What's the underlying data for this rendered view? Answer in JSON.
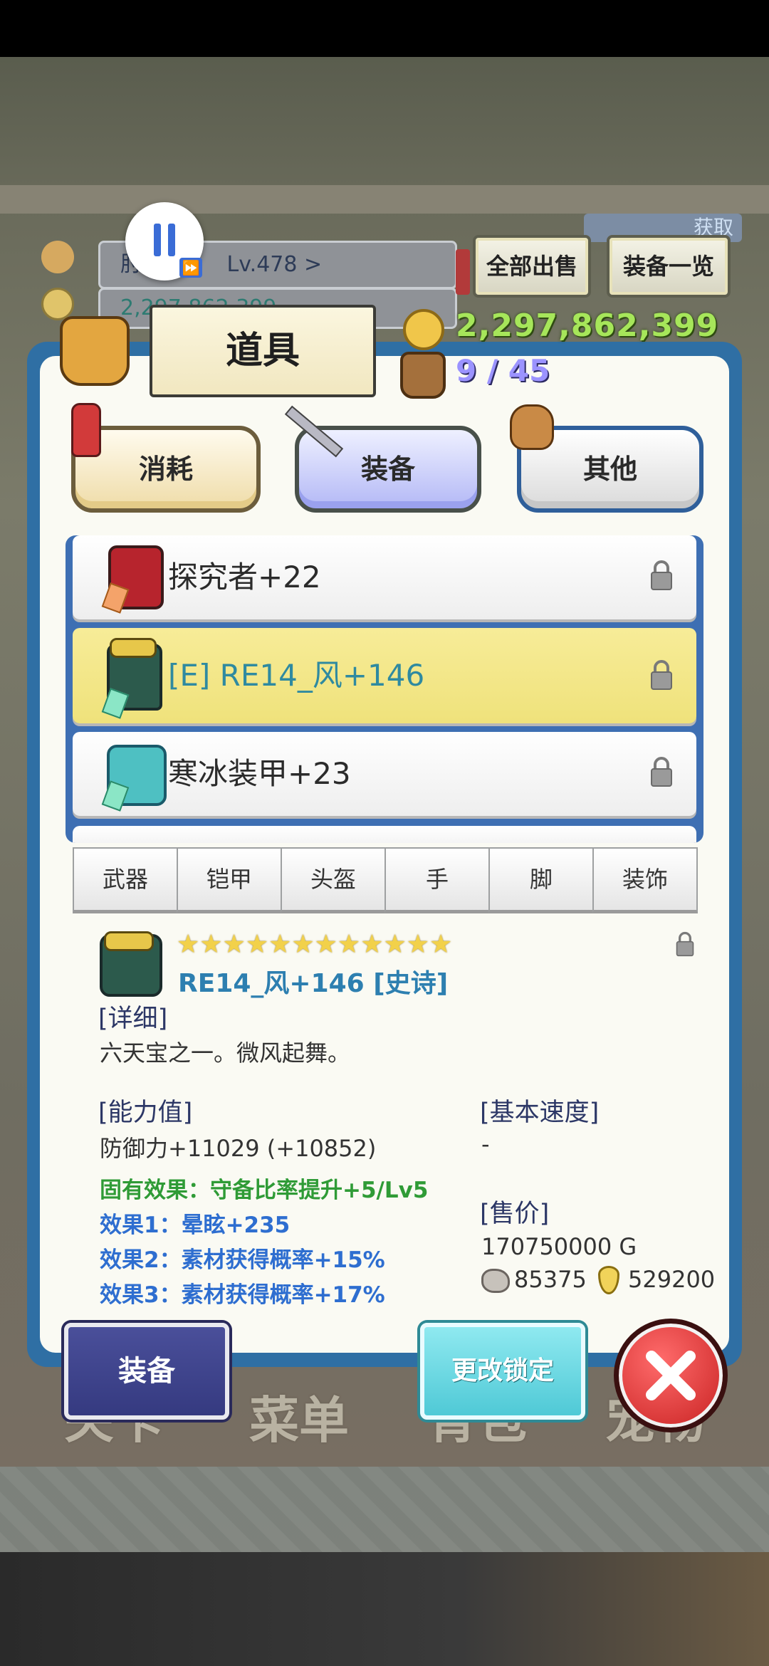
{
  "background_nav": [
    "关卡",
    "菜单",
    "背包",
    "宠物"
  ],
  "hud": {
    "player_level": "Lv.478 >",
    "player_name_fragment": "肘",
    "gold_behind": "2,297,862,399",
    "sell_all_label": "全部出售",
    "equip_list_label": "装备一览",
    "obtain_label": "获取"
  },
  "panel": {
    "title": "道具",
    "gold": "2,297,862,399",
    "slots": "9 / 45",
    "tabs": [
      "消耗",
      "装备",
      "其他"
    ],
    "selected_tab": "装备",
    "items": [
      {
        "name": "探究者+22",
        "selected": false
      },
      {
        "name": "[E] RE14_风+146",
        "selected": true
      },
      {
        "name": "寒冰装甲+23",
        "selected": false
      }
    ],
    "categories": [
      "武器",
      "铠甲",
      "头盔",
      "手",
      "脚",
      "装饰"
    ]
  },
  "detail": {
    "stars": "★★★★★★★★★★★★",
    "item_title": "RE14_风+146 [史诗]",
    "detail_header": "[详细]",
    "description": "六天宝之一。微风起舞。",
    "ability_header": "[能力值]",
    "defense": "防御力+11029 (+10852)",
    "inherent_effect": "固有效果：守备比率提升+5/Lv5",
    "effect1": "效果1：晕眩+235",
    "effect2": "效果2：素材获得概率+15%",
    "effect3": "效果3：素材获得概率+17%",
    "speed_header": "[基本速度]",
    "speed_value": "-",
    "price_header": "[售价]",
    "price": "170750000 G",
    "stone_value": "85375",
    "drop_value": "529200"
  },
  "buttons": {
    "equip_label": "装备",
    "change_lock_label": "更改锁定"
  },
  "colors": {
    "panel_border": "#2f6fa4",
    "selected_row": "#f3e885",
    "gold_text": "#a6e65a",
    "effect_green": "#2f9b36",
    "effect_blue": "#2e6ed0",
    "close_red": "#d93333"
  }
}
